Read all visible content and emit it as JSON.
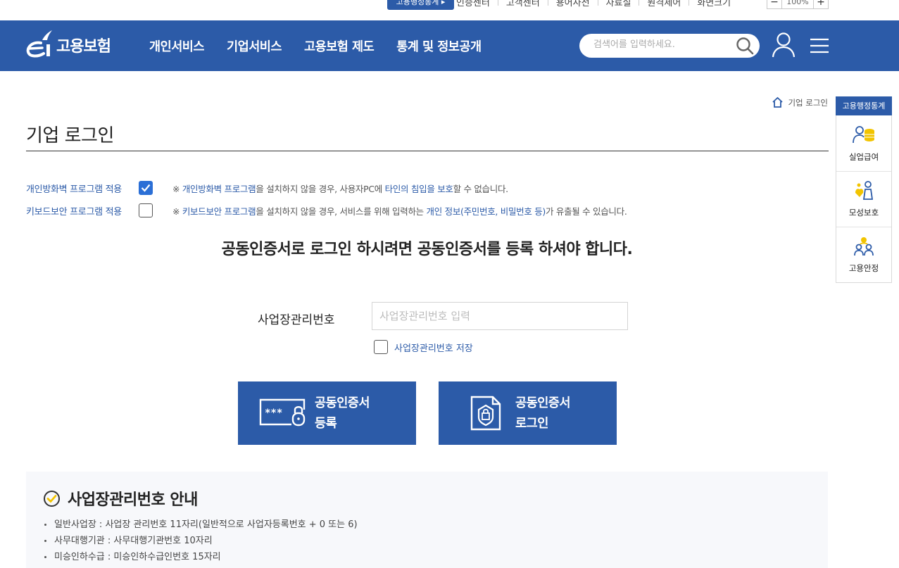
{
  "utility": {
    "stats_badge": "고용행정통계 ▸",
    "links": [
      "인증센터",
      "고객센터",
      "용어사전",
      "자료실",
      "원격제어",
      "화면크기"
    ],
    "zoom_minus": "−",
    "zoom_value": "100%",
    "zoom_plus": "+"
  },
  "header": {
    "logo_text": "고용보험",
    "nav": [
      "개인서비스",
      "기업서비스",
      "고용보험 제도",
      "통계 및 정보공개"
    ],
    "search_placeholder": "검색어를 입력하세요."
  },
  "quick_menu": {
    "title": "고용행정통계",
    "items": [
      {
        "label": "실업급여",
        "icon": "unemployment-benefit-icon"
      },
      {
        "label": "모성보호",
        "icon": "maternity-protection-icon"
      },
      {
        "label": "고용안정",
        "icon": "employment-stability-icon"
      }
    ]
  },
  "breadcrumb": {
    "current": "기업 로그인"
  },
  "page_title": "기업 로그인",
  "options": {
    "firewall": {
      "label": "개인방화벽 프로그램 적용",
      "checked": true,
      "note_prefix": "※ ",
      "note_hl1": "개인방화벽 프로그램",
      "note_mid1": "을 설치하지 않을 경우, 사용자PC에 ",
      "note_hl2": "타인의 침입을 보호",
      "note_end": "할 수 없습니다."
    },
    "keyboard": {
      "label": "키보드보안 프로그램 적용",
      "checked": false,
      "note_prefix": "※ ",
      "note_hl1": "키보드보안 프로그램",
      "note_mid1": "을 설치하지 않을 경우, 서비스를 위해 입력하는 ",
      "note_hl2": "개인 정보(주민번호, 비밀번호 등)",
      "note_end": "가 유출될 수 있습니다."
    }
  },
  "notice": "공동인증서로 로그인 하시려면 공동인증서를 등록 하셔야 합니다.",
  "form": {
    "label": "사업장관리번호",
    "value": "",
    "placeholder": "사업장관리번호 입력",
    "save_label": "사업장관리번호 저장",
    "save_checked": false
  },
  "buttons": {
    "register_line1": "공동인증서",
    "register_line2": "등록",
    "login_line1": "공동인증서",
    "login_line2": "로그인"
  },
  "guide": {
    "title": "사업장관리번호 안내",
    "items": [
      "일반사업장 : 사업장 관리번호 11자리(일반적으로 사업자등록번호 + 0 또는 6)",
      "사무대행기관 : 사무대행기관번호 10자리",
      "미승인하수급 : 미승인하수급인번호 15자리"
    ]
  },
  "colors": {
    "brand": "#2c5ba8",
    "checkbox_on": "#2b6fd6",
    "guide_bg": "#f7f8fb",
    "check_circle": "#f2c400"
  }
}
